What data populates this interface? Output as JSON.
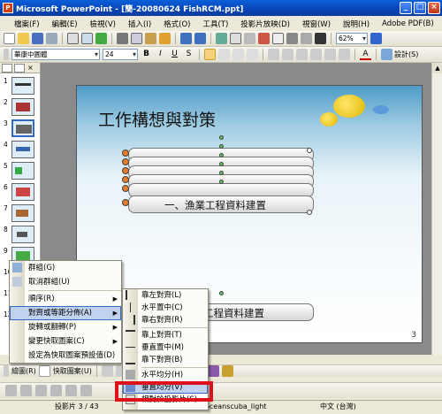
{
  "window": {
    "title": "Microsoft PowerPoint - [簡-20080624 FishRCM.ppt]"
  },
  "menubar": {
    "items": [
      "檔案(F)",
      "編輯(E)",
      "檢視(V)",
      "插入(I)",
      "格式(O)",
      "工具(T)",
      "投影片放映(D)",
      "視窗(W)",
      "說明(H)",
      "Adobe PDF(B)"
    ],
    "zoom": "62%"
  },
  "format_toolbar": {
    "font": "華康中圓體",
    "size": "24",
    "design_label": "設計(S)"
  },
  "slides": [
    "1",
    "2",
    "3",
    "4",
    "5",
    "6",
    "7",
    "8",
    "9",
    "10",
    "11",
    "12"
  ],
  "slide": {
    "title": "工作構想與對策",
    "label_top": "一、漁業工程資料建置",
    "label_bottom": "工程資料建置",
    "page_number": "3"
  },
  "context_menu": {
    "items": [
      {
        "label": "群組(G)",
        "arrow": false
      },
      {
        "label": "取消群組(U)",
        "arrow": false
      },
      {
        "label": "順序(R)",
        "arrow": true
      },
      {
        "label": "對齊或等距分佈(A)",
        "arrow": true
      },
      {
        "label": "旋轉或翻轉(P)",
        "arrow": true
      },
      {
        "label": "變更快取圖案(C)",
        "arrow": true
      },
      {
        "label": "設定為快取圖案預設值(D)",
        "arrow": false
      }
    ]
  },
  "align_submenu": {
    "items": [
      "靠左對齊(L)",
      "水平置中(C)",
      "靠右對齊(R)",
      "靠上對齊(T)",
      "垂直置中(M)",
      "靠下對齊(B)",
      "水平均分(H)",
      "垂直均分(V)",
      "相對於投影片(S)"
    ]
  },
  "drawing_toolbar": {
    "draw_label": "繪圖(R)",
    "autoshape_label": "快取圖案(U)"
  },
  "statusbar": {
    "slide_info": "投影片 3 / 43",
    "template": "oceanscuba_light",
    "language": "中文 (台灣)"
  },
  "colors": {
    "highlight": "#e0101a",
    "menu_hover": "#c1d2ee",
    "title_bar": "#0a5fd9"
  }
}
